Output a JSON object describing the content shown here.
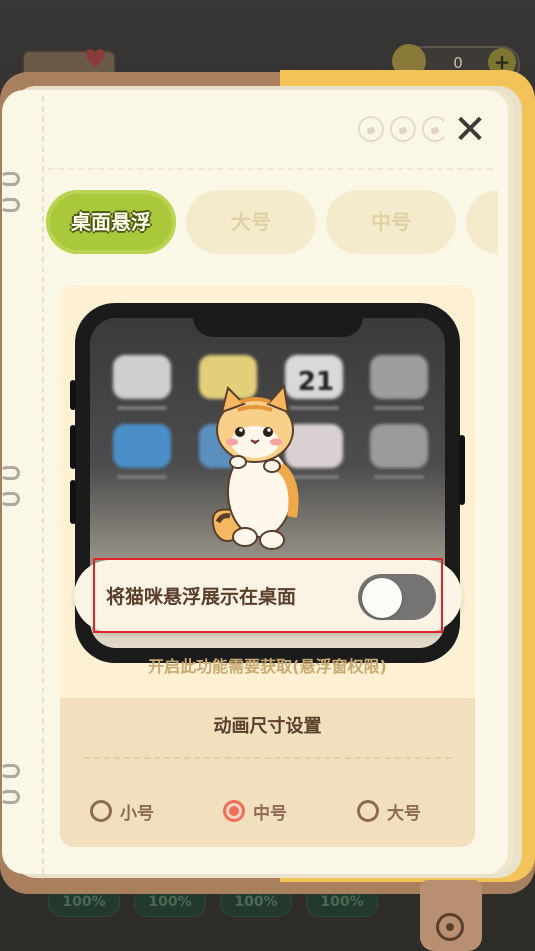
{
  "background": {
    "coin_count": "0",
    "footer_pills": [
      "100%",
      "100%",
      "100%",
      "100%"
    ]
  },
  "header": {
    "close_label": "✕"
  },
  "tabs": [
    {
      "label": "桌面悬浮",
      "active": true
    },
    {
      "label": "大号",
      "active": false
    },
    {
      "label": "中号",
      "active": false
    },
    {
      "label": ""
    }
  ],
  "preview": {
    "calendar_day": "21",
    "toggle_label": "将猫咪悬浮展示在桌面",
    "toggle_on": false
  },
  "permission_note": "开启此功能需要获取(悬浮窗权限)",
  "size_settings": {
    "title": "动画尺寸设置",
    "options": [
      {
        "label": "小号",
        "selected": false
      },
      {
        "label": "中号",
        "selected": true
      },
      {
        "label": "大号",
        "selected": false
      }
    ]
  },
  "colors": {
    "accent_green": "#a9c83a",
    "radio_selected": "#f06f5b",
    "brown_text": "#5a3f2d",
    "highlight_red": "#e0252a"
  }
}
